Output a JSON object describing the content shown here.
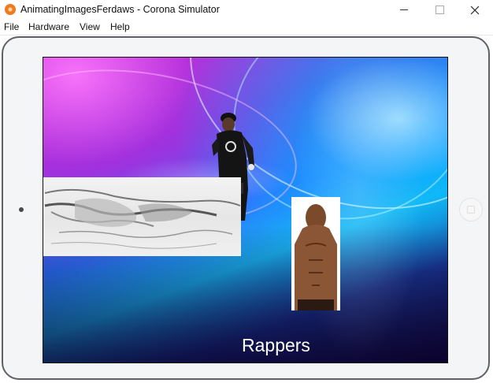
{
  "window": {
    "title": "AnimatingImagesFerdaws - Corona Simulator",
    "icon": "corona-icon"
  },
  "menu": {
    "items": [
      {
        "label": "File"
      },
      {
        "label": "Hardware"
      },
      {
        "label": "View"
      },
      {
        "label": "Help"
      }
    ]
  },
  "screen": {
    "caption": "Rappers"
  },
  "colors": {
    "frame": "#5f6065",
    "device_bg": "#f4f5f7",
    "accent_orange": "#f07a1e"
  }
}
